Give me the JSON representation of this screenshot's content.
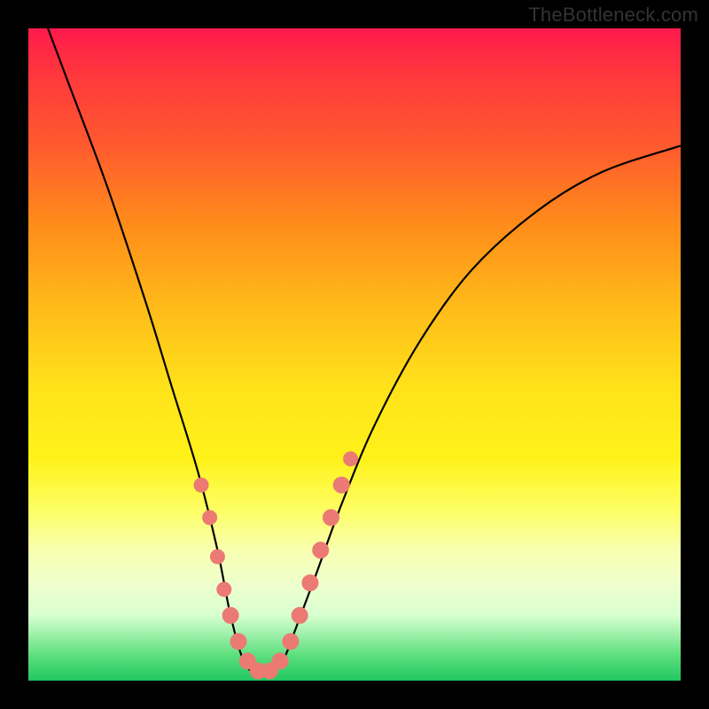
{
  "watermark": "TheBottleneck.com",
  "colors": {
    "frame": "#000000",
    "curve": "#000000",
    "bead": "#ec7a74",
    "gradient_stops": [
      "#ff1a4d",
      "#ff3b3b",
      "#ff5a2e",
      "#ff8c1a",
      "#ffb81a",
      "#ffe21a",
      "#fff21a",
      "#fdff66",
      "#f8ffb0",
      "#efffcc",
      "#d8ffd0",
      "#5fe07f",
      "#20c760"
    ]
  },
  "chart_data": {
    "type": "line",
    "title": "",
    "xlabel": "",
    "ylabel": "",
    "xlim": [
      0,
      100
    ],
    "ylim": [
      0,
      100
    ],
    "note": "x is horizontal position as % of plot width (left→right); y is height as % of plot (0 = bottom/green, 100 = top/red). Two monotone segments meeting at a flat minimum near x≈33–38.",
    "series": [
      {
        "name": "bottleneck-curve",
        "x": [
          0,
          6,
          12,
          18,
          22,
          26,
          29,
          31,
          33,
          35,
          37,
          39,
          41,
          44,
          48,
          53,
          60,
          68,
          78,
          88,
          100
        ],
        "y": [
          108,
          92,
          76,
          58,
          45,
          32,
          20,
          10,
          3,
          1,
          1,
          3,
          8,
          16,
          27,
          39,
          52,
          63,
          72,
          78,
          82
        ]
      }
    ],
    "beads": {
      "note": "salmon markers clustered near the trough on both sides",
      "points": [
        {
          "x": 26.5,
          "y": 30,
          "r": 8
        },
        {
          "x": 27.8,
          "y": 25,
          "r": 8
        },
        {
          "x": 29.0,
          "y": 19,
          "r": 8
        },
        {
          "x": 30.0,
          "y": 14,
          "r": 8
        },
        {
          "x": 31.0,
          "y": 10,
          "r": 9
        },
        {
          "x": 32.2,
          "y": 6,
          "r": 9
        },
        {
          "x": 33.6,
          "y": 3,
          "r": 9
        },
        {
          "x": 35.2,
          "y": 1.5,
          "r": 9
        },
        {
          "x": 37.0,
          "y": 1.5,
          "r": 9
        },
        {
          "x": 38.6,
          "y": 3,
          "r": 9
        },
        {
          "x": 40.2,
          "y": 6,
          "r": 9
        },
        {
          "x": 41.6,
          "y": 10,
          "r": 9
        },
        {
          "x": 43.2,
          "y": 15,
          "r": 9
        },
        {
          "x": 44.8,
          "y": 20,
          "r": 9
        },
        {
          "x": 46.4,
          "y": 25,
          "r": 9
        },
        {
          "x": 48.0,
          "y": 30,
          "r": 9
        },
        {
          "x": 49.4,
          "y": 34,
          "r": 8
        }
      ]
    }
  }
}
